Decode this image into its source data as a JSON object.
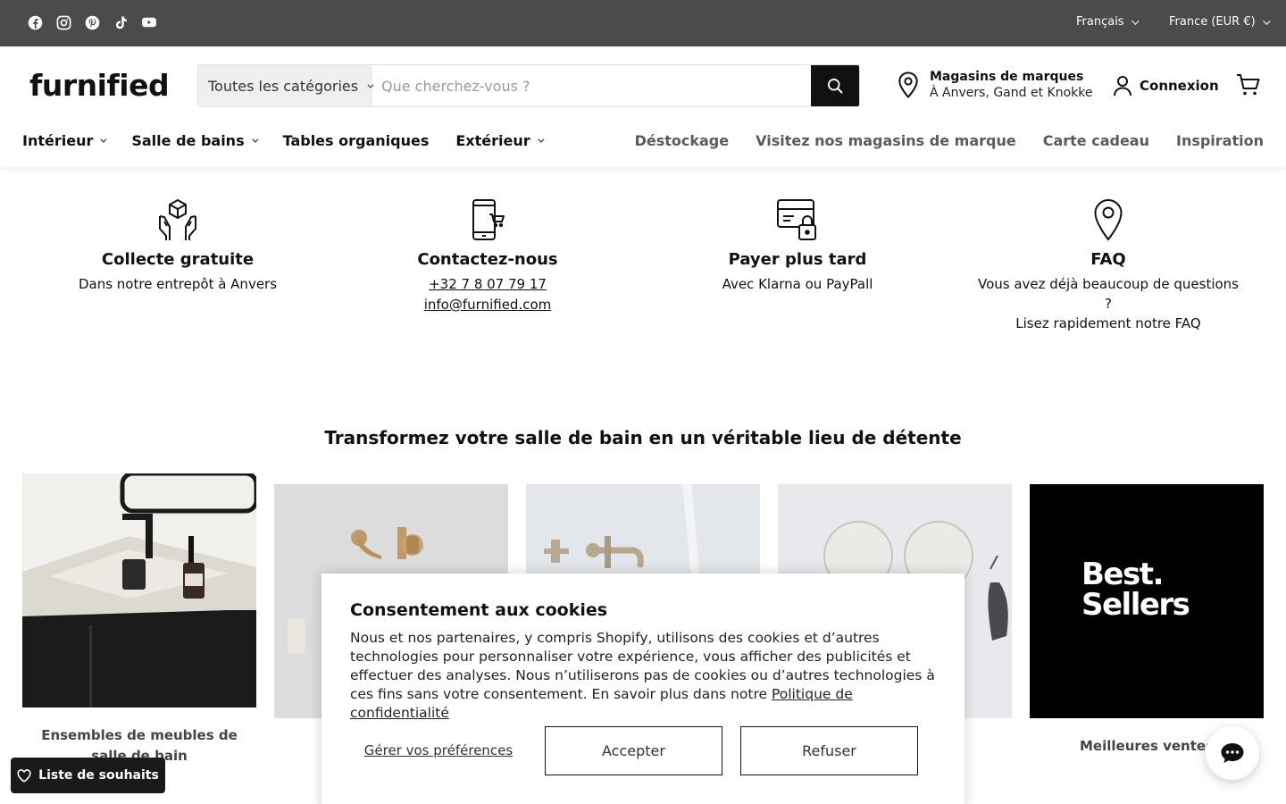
{
  "topbar": {
    "social": [
      "facebook-icon",
      "instagram-icon",
      "pinterest-icon",
      "tiktok-icon",
      "youtube-icon"
    ],
    "language": "Français",
    "country": "France (EUR €)"
  },
  "header": {
    "logo": "furnified",
    "search": {
      "category": "Toutes les catégories",
      "placeholder": "Que cherchez-vous ?"
    },
    "stores": {
      "title": "Magasins de marques",
      "subtitle": "À Anvers, Gand et Knokke"
    },
    "login": "Connexion"
  },
  "nav": {
    "left": [
      {
        "label": "Intérieur",
        "dropdown": true
      },
      {
        "label": "Salle de bains",
        "dropdown": true
      },
      {
        "label": "Tables organiques",
        "dropdown": false
      },
      {
        "label": "Extérieur",
        "dropdown": true
      }
    ],
    "right": [
      "Déstockage",
      "Visitez nos magasins de marque",
      "Carte cadeau",
      "Inspiration"
    ]
  },
  "features": [
    {
      "title": "Collecte gratuite",
      "text": "Dans notre entrepôt à Anvers"
    },
    {
      "title": "Contactez-nous",
      "phone": "+32 7 8 07 79 17",
      "email": "info@furnified.com"
    },
    {
      "title": "Payer plus tard",
      "text": "Avec Klarna ou PayPall"
    },
    {
      "title": "FAQ",
      "text": "Vous avez déjà beaucoup de questions ?",
      "text2": "Lisez rapidement notre FAQ"
    }
  ],
  "section_title": "Transformez votre salle de bain en un véritable lieu de détente",
  "cards": [
    {
      "label": "Ensembles de meubles de salle de bain"
    },
    {
      "label": ""
    },
    {
      "label": ""
    },
    {
      "label": ""
    },
    {
      "label": "Meilleures ventes",
      "image_text_1": "Best.",
      "image_text_2": "Sellers"
    }
  ],
  "cookie": {
    "title": "Consentement aux cookies",
    "body": "Nous et nos partenaires, y compris Shopify, utilisons des cookies et d’autres technologies pour personnaliser votre expérience, vous afficher des publicités et effectuer des analyses. Nous n’utiliserons pas de cookies ou d’autres technologies à ces fins sans votre consentement. En savoir plus dans notre ",
    "policy_link": "Politique de confidentialité",
    "manage": "Gérer vos préférences",
    "accept": "Accepter",
    "decline": "Refuser"
  },
  "wishlist": "Liste de souhaits",
  "colors": {
    "topbar": "#4b4b4b",
    "accent": "#111111"
  }
}
